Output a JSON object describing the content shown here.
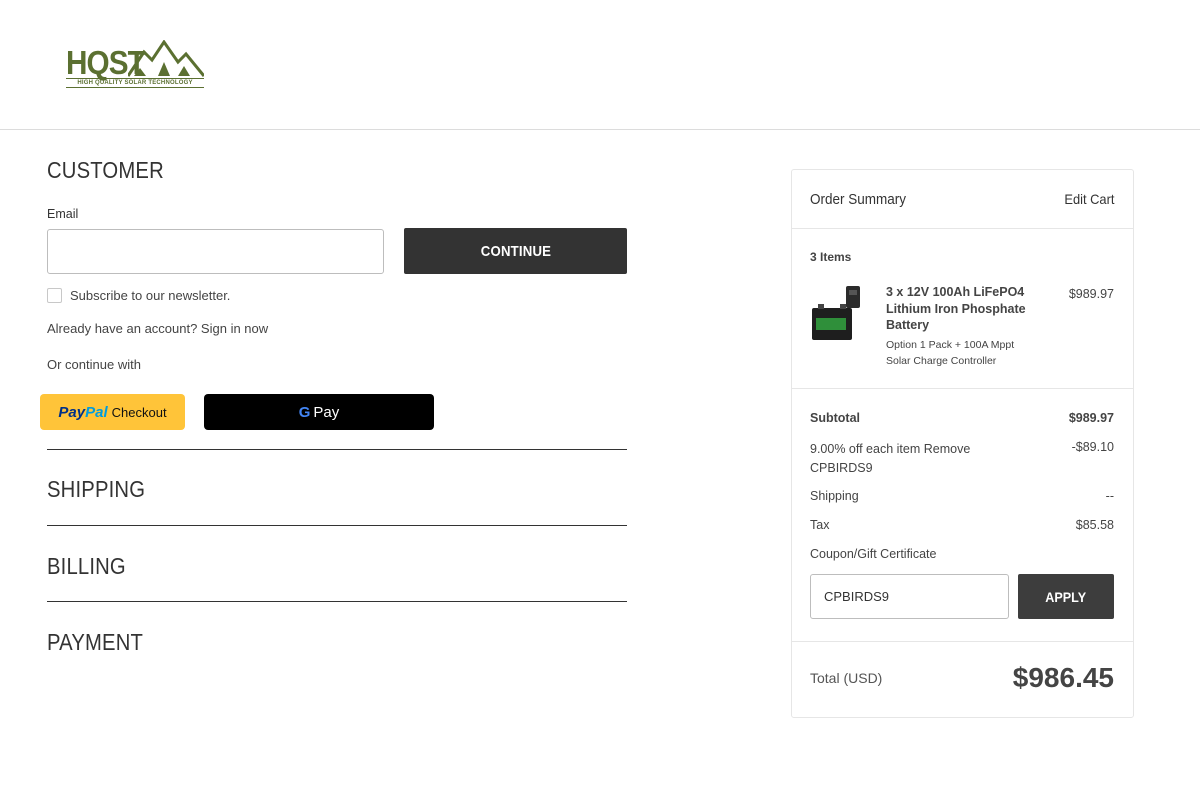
{
  "brand": {
    "logo_text": "HQST",
    "logo_tagline": "HIGH QUALITY SOLAR TECHNOLOGY",
    "color": "#5b7031"
  },
  "customer": {
    "section_title": "CUSTOMER",
    "email_label": "Email",
    "email_value": "",
    "continue_label": "CONTINUE",
    "newsletter_label": "Subscribe to our newsletter.",
    "newsletter_checked": false,
    "signin_text": "Already have an account? Sign in now",
    "or_continue": "Or continue with",
    "paypal_brand_1": "Pay",
    "paypal_brand_2": "Pal",
    "paypal_label": "Checkout",
    "gpay_g": "G",
    "gpay_label": "Pay"
  },
  "sections": {
    "shipping": "SHIPPING",
    "billing": "BILLING",
    "payment": "PAYMENT"
  },
  "summary": {
    "title": "Order Summary",
    "edit_cart": "Edit Cart",
    "items_count": "3 Items",
    "product": {
      "name": "3 x 12V 100Ah LiFePO4 Lithium Iron Phosphate Battery",
      "option": "Option 1 Pack + 100A Mppt Solar Charge Controller",
      "price": "$989.97"
    },
    "subtotal_label": "Subtotal",
    "subtotal_value": "$989.97",
    "discount_label": "9.00% off each item Remove CPBIRDS9",
    "discount_value": "-$89.10",
    "shipping_label": "Shipping",
    "shipping_value": "--",
    "tax_label": "Tax",
    "tax_value": "$85.58",
    "coupon_label": "Coupon/Gift Certificate",
    "coupon_value": "CPBIRDS9",
    "apply_label": "APPLY",
    "total_label": "Total (USD)",
    "total_value": "$986.45"
  },
  "colors": {
    "dark_button": "#333333",
    "paypal_yellow": "#ffc439",
    "gpay_black": "#000000"
  }
}
